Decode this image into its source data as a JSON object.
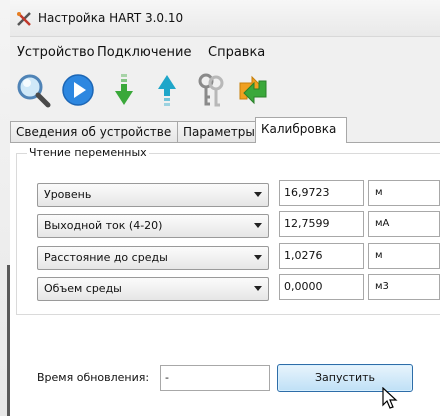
{
  "window": {
    "title": "Настройка HART 3.0.10"
  },
  "menu": {
    "device": "Устройство",
    "connection": "Подключение",
    "help": "Справка"
  },
  "toolbar": {
    "buttons": [
      {
        "icon": "search-icon"
      },
      {
        "icon": "play-icon"
      },
      {
        "icon": "download-arrow-icon"
      },
      {
        "icon": "upload-arrow-icon"
      },
      {
        "icon": "keys-icon"
      },
      {
        "icon": "swap-icon"
      }
    ]
  },
  "tabs": {
    "device_info": "Сведения об устройстве",
    "parameters": "Параметры",
    "calibration": "Калибровка"
  },
  "group": {
    "title": "Чтение переменных",
    "rows": [
      {
        "variable": "Уровень",
        "value": "16,9723",
        "unit": "м"
      },
      {
        "variable": "Выходной ток (4-20)",
        "value": "12,7599",
        "unit": "мА"
      },
      {
        "variable": "Расстояние до среды",
        "value": "1,0276",
        "unit": "м"
      },
      {
        "variable": "Объем среды",
        "value": "0,0000",
        "unit": "м3"
      }
    ]
  },
  "update": {
    "label": "Время обновления:",
    "value": "-"
  },
  "start_button": "Запустить",
  "colors": {
    "button_border": "#2e6da8",
    "play_blue": "#2d87e0",
    "green_arrow": "#3aa83a",
    "teal_arrow": "#1fa6c9"
  }
}
